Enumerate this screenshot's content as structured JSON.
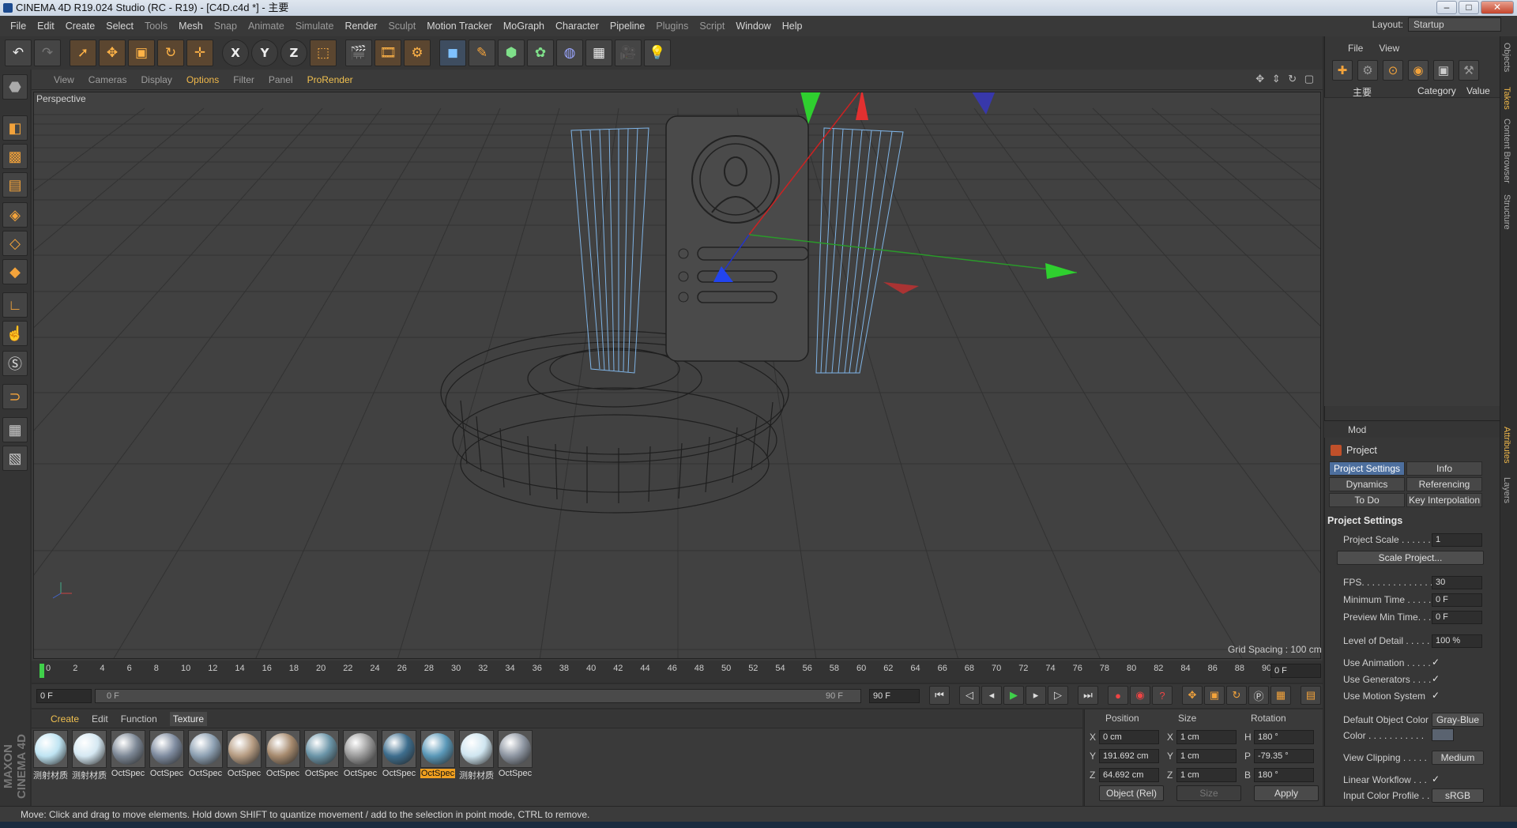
{
  "window": {
    "title": "CINEMA 4D R19.024 Studio (RC - R19) - [C4D.c4d *] - 主要",
    "min": "–",
    "max": "□",
    "close": "✕"
  },
  "menu": [
    "File",
    "Edit",
    "Create",
    "Select",
    "Tools",
    "Mesh",
    "Snap",
    "Animate",
    "Simulate",
    "Render",
    "Sculpt",
    "Motion Tracker",
    "MoGraph",
    "Character",
    "Pipeline",
    "Plugins",
    "Script",
    "Window",
    "Help"
  ],
  "layout": {
    "label": "Layout:",
    "value": "Startup"
  },
  "viewport": {
    "menu": [
      "View",
      "Cameras",
      "Display",
      "Options",
      "Filter",
      "Panel",
      "ProRender"
    ],
    "camera_label": "Perspective",
    "grid_spacing": "Grid Spacing : 100 cm",
    "nav_icons": "✥ ⇕ ↻ ▢"
  },
  "timeline": {
    "ticks": [
      "0",
      "2",
      "4",
      "6",
      "8",
      "10",
      "12",
      "14",
      "16",
      "18",
      "20",
      "22",
      "24",
      "26",
      "28",
      "30",
      "32",
      "34",
      "36",
      "38",
      "40",
      "42",
      "44",
      "46",
      "48",
      "50",
      "52",
      "54",
      "56",
      "58",
      "60",
      "62",
      "64",
      "66",
      "68",
      "70",
      "72",
      "74",
      "76",
      "78",
      "80",
      "82",
      "84",
      "86",
      "88",
      "90"
    ],
    "current_frame": "0 F",
    "start": "0 F",
    "scrub_start": "0 F",
    "scrub_end": "90 F",
    "end": "90 F"
  },
  "materials": {
    "menu": [
      "Create",
      "Edit",
      "Function",
      "Texture"
    ],
    "active_menu": "Texture",
    "items": [
      {
        "name": "测射材质",
        "color": "#bfe4f2"
      },
      {
        "name": "测射材质",
        "color": "#d5e8f2"
      },
      {
        "name": "OctSpec",
        "color": "#7d8896"
      },
      {
        "name": "OctSpec",
        "color": "#7f8ca0"
      },
      {
        "name": "OctSpec",
        "color": "#8da0b2"
      },
      {
        "name": "OctSpec",
        "color": "#b69c82"
      },
      {
        "name": "OctSpec",
        "color": "#a68a6e"
      },
      {
        "name": "OctSpec",
        "color": "#6b95a8"
      },
      {
        "name": "OctSpec",
        "color": "#9a9a9a"
      },
      {
        "name": "OctSpec",
        "color": "#3e6e8e"
      },
      {
        "name": "OctSpec",
        "color": "#5a98b8"
      },
      {
        "name": "测射材质",
        "color": "#cfe5f0"
      },
      {
        "name": "OctSpec",
        "color": "#8e96a2"
      }
    ],
    "selected_index": 10
  },
  "coords": {
    "headers": [
      "Position",
      "Size",
      "Rotation"
    ],
    "rows": [
      {
        "axis": "X",
        "pos": "0 cm",
        "saxis": "X",
        "size": "1 cm",
        "raxis": "H",
        "rot": "180 °"
      },
      {
        "axis": "Y",
        "pos": "191.692 cm",
        "saxis": "Y",
        "size": "1 cm",
        "raxis": "P",
        "rot": "-79.35 °"
      },
      {
        "axis": "Z",
        "pos": "64.692 cm",
        "saxis": "Z",
        "size": "1 cm",
        "raxis": "B",
        "rot": "180 °"
      }
    ],
    "mode": "Object (Rel)",
    "size_mode": "Size",
    "apply": "Apply"
  },
  "objects": {
    "menu": [
      "File",
      "View"
    ],
    "col_name": "主要",
    "col_category": "Category",
    "col_value": "Value"
  },
  "attributes": {
    "mode": "Mod",
    "title": "Project",
    "tabs": [
      "Project Settings",
      "Info",
      "Dynamics",
      "Referencing",
      "To Do",
      "Key Interpolation"
    ],
    "section": "Project Settings",
    "fields": [
      {
        "label": "Project Scale . . . . . .",
        "value": "1"
      },
      {
        "label": "FPS. . . . . . . . . . . . . . .",
        "value": "30"
      },
      {
        "label": "Minimum Time . . . . .",
        "value": "0 F"
      },
      {
        "label": "Preview Min Time. . .",
        "value": "0 F"
      },
      {
        "label": "Level of Detail . . . . .",
        "value": "100 %"
      }
    ],
    "scale_btn": "Scale Project...",
    "checks": [
      {
        "label": "Use Animation . . . . .",
        "value": "✓"
      },
      {
        "label": "Use Generators . . . .",
        "value": "✓"
      },
      {
        "label": "Use Motion System",
        "value": "✓"
      }
    ],
    "def_color_label": "Default Object Color",
    "def_color_value": "Gray-Blue",
    "color_label": "Color . . . . . . . . . . .",
    "clip_label": "View Clipping . . . . .",
    "clip_value": "Medium",
    "linear_label": "Linear Workflow . . .",
    "linear_value": "✓",
    "profile_label": "Input Color Profile . .",
    "profile_value": "sRGB"
  },
  "side_tabs": [
    "Objects",
    "Takes",
    "Content Browser",
    "Structure",
    "Attributes",
    "Layers"
  ],
  "status": "Move: Click and drag to move elements. Hold down SHIFT to quantize movement / add to the selection in point mode, CTRL to remove.",
  "brand": "MAXON CINEMA 4D",
  "colors": {
    "accent": "#f0b84a",
    "tab_active": "#4d6f9e",
    "selected_material": "#f0a020"
  }
}
